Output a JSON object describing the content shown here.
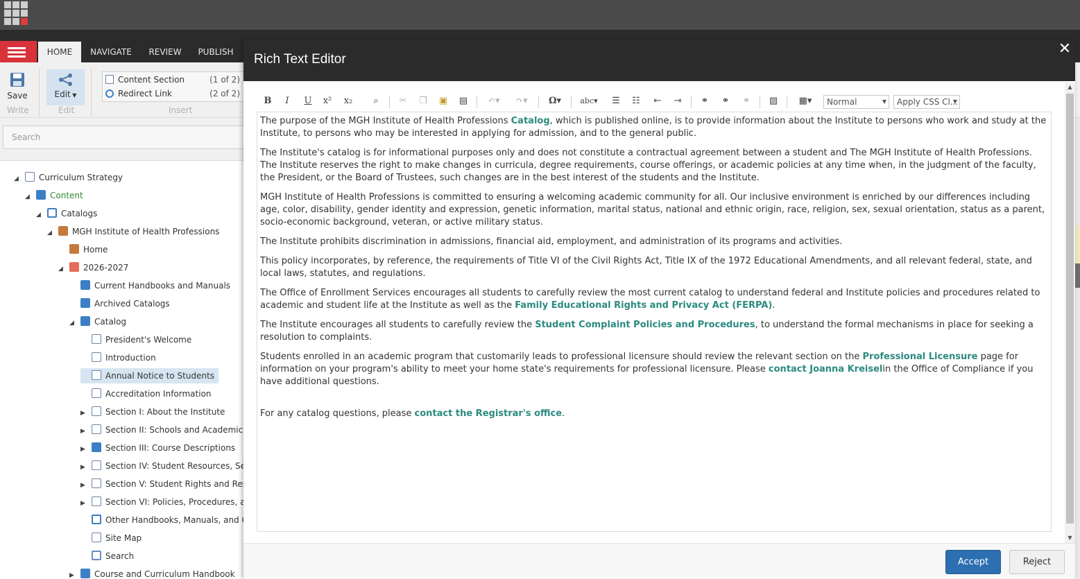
{
  "ribbon": {
    "tabs": [
      "HOME",
      "NAVIGATE",
      "REVIEW",
      "PUBLISH"
    ],
    "save_label": "Save",
    "write_label": "Write",
    "edit_label": "Edit",
    "edit_group_label": "Edit",
    "insert_group_label": "Insert",
    "insert_items": [
      {
        "label": "Content Section",
        "count": "(1 of 2)"
      },
      {
        "label": "Redirect Link",
        "count": "(2 of 2)"
      }
    ]
  },
  "search": {
    "placeholder": "Search"
  },
  "tree": [
    {
      "label": "Curriculum Strategy",
      "arrow": "◢",
      "icon": "doc"
    },
    {
      "label": "Content",
      "arrow": "◢",
      "icon": "blue"
    },
    {
      "label": "Catalogs",
      "arrow": "◢",
      "icon": "link"
    },
    {
      "label": "MGH Institute of Health Professions",
      "arrow": "◢",
      "icon": "book"
    },
    {
      "label": "Home",
      "arrow": "",
      "icon": "book"
    },
    {
      "label": "2026-2027",
      "arrow": "◢",
      "icon": "cal"
    },
    {
      "label": "Current Handbooks and Manuals",
      "arrow": "",
      "icon": "blue"
    },
    {
      "label": "Archived Catalogs",
      "arrow": "",
      "icon": "blue"
    },
    {
      "label": "Catalog",
      "arrow": "◢",
      "icon": "blue"
    },
    {
      "label": "President's Welcome",
      "arrow": "",
      "icon": "doc"
    },
    {
      "label": "Introduction",
      "arrow": "",
      "icon": "doc"
    },
    {
      "label": "Annual Notice to Students",
      "arrow": "",
      "icon": "doc"
    },
    {
      "label": "Accreditation Information",
      "arrow": "",
      "icon": "doc"
    },
    {
      "label": "Section I: About the Institute",
      "arrow": "▶",
      "icon": "doc"
    },
    {
      "label": "Section II: Schools and Academic Of",
      "arrow": "▶",
      "icon": "doc"
    },
    {
      "label": "Section III: Course Descriptions",
      "arrow": "▶",
      "icon": "blue"
    },
    {
      "label": "Section IV: Student Resources, Serv",
      "arrow": "▶",
      "icon": "doc"
    },
    {
      "label": "Section V: Student Rights and Respo",
      "arrow": "▶",
      "icon": "doc"
    },
    {
      "label": "Section VI: Policies, Procedures, and",
      "arrow": "▶",
      "icon": "doc"
    },
    {
      "label": "Other Handbooks, Manuals, and Gu",
      "arrow": "",
      "icon": "link"
    },
    {
      "label": "Site Map",
      "arrow": "",
      "icon": "doc"
    },
    {
      "label": "Search",
      "arrow": "",
      "icon": "search"
    },
    {
      "label": "Course and Curriculum Handbook",
      "arrow": "▶",
      "icon": "blue"
    }
  ],
  "dialog": {
    "title": "Rich Text Editor",
    "close_symbol": "✕",
    "format_select": "Normal",
    "css_select": "Apply CSS Cl...",
    "accept_label": "Accept",
    "reject_label": "Reject",
    "paragraphs": [
      {
        "p1_a": "The purpose of the MGH Institute of Health Professions ",
        "link": "Catalog",
        "p1_b": ", which is published online, is to provide information about the Institute to persons who work and study at the Institute, to persons who may be interested in applying for admission, and to the general public."
      },
      {
        "text": "The Institute's catalog is for informational purposes only and does not constitute a contractual agreement between a student and The MGH Institute of Health Professions. The Institute reserves the right to make changes in curricula, degree requirements, course offerings, or academic policies at any time when, in the judgment of the faculty, the President, or the Board of Trustees, such changes are in the best interest of the students and the Institute."
      },
      {
        "text": "MGH Institute of Health Professions is committed to ensuring a welcoming academic community for all. Our inclusive environment is enriched by our differences including age, color, disability, gender identity and expression, genetic information, marital status, national and ethnic origin, race, religion, sex, sexual orientation, status as a parent, socio-economic background, veteran, or active military status."
      },
      {
        "text": "The Institute prohibits discrimination in admissions, financial aid, employment, and administration of its programs and activities."
      },
      {
        "text": "This policy incorporates, by reference, the requirements of Title VI of the Civil Rights Act, Title IX of the 1972 Educational Amendments, and all relevant federal, state, and local laws, statutes, and regulations."
      },
      {
        "p1_a": "The Office of Enrollment Services encourages all students to carefully review the most current catalog to understand federal and Institute policies and procedures related to academic and student life at the Institute as well as the ",
        "link": "Family Educational Rights and Privacy Act (FERPA)",
        "p1_b": "."
      },
      {
        "p1_a": "The Institute encourages all students to carefully review the ",
        "link": "Student Complaint Policies and Procedures",
        "p1_b": ", to understand the formal mechanisms in place for seeking a resolution to complaints."
      },
      {
        "p1_a": "Students enrolled in an academic program that customarily leads to professional licensure should review the relevant section on the ",
        "link": "Professional Licensure",
        "p1_b": " page for information on your program's ability to meet your home state's requirements for professional licensure. Please ",
        "link2": "contact Joanna Kreisel",
        "p1_c": "in the Office of Compliance if you have additional questions."
      },
      {
        "p1_a": "For any catalog questions, please ",
        "link": "contact the Registrar's office",
        "p1_b": "."
      }
    ]
  }
}
